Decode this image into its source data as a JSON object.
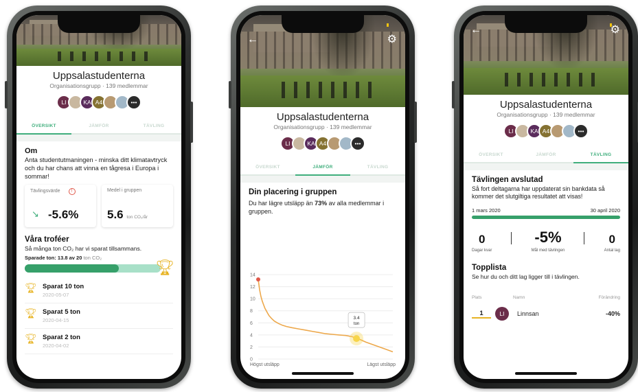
{
  "group": {
    "name": "Uppsalastudenterna",
    "type": "Organisationsgrupp",
    "separator": "·",
    "members": "139 medlemmar"
  },
  "avatars": [
    {
      "initials": "LI",
      "color": "#6b2d4a"
    },
    {
      "initials": "",
      "color": "#c9b8a0"
    },
    {
      "initials": "KA",
      "color": "#5a2c5c"
    },
    {
      "initials": "A4",
      "color": "#857232"
    },
    {
      "initials": "",
      "color": "#b89a72"
    },
    {
      "initials": "",
      "color": "#a2b8c8"
    },
    {
      "initials": "•••",
      "color": "#2b2b2b"
    }
  ],
  "tabs": {
    "overview": "ÖVERSIKT",
    "compare": "JÄMFÖR",
    "competition": "TÄVLING"
  },
  "overview": {
    "about_title": "Om",
    "about_text": "Anta studentutmaningen - minska ditt klimatavtryck och du har chans att vinna en tågresa i Europa i sommar!",
    "comp_label": "Tävlingsvärde",
    "comp_value": "-5.6%",
    "avg_label": "Medel i gruppen",
    "avg_value": "5.6",
    "avg_unit": "ton CO₂/år",
    "trophies_title": "Våra troféer",
    "trophies_text": "Så många ton CO₂ har vi sparat tillsammans.",
    "saved_label": "Sparade ton: 13.8 av 20",
    "saved_unit": "ton CO₂",
    "saved_value": 13.8,
    "saved_total": 20,
    "trophies": [
      {
        "name": "Sparat 10 ton",
        "date": "2020-05-07"
      },
      {
        "name": "Sparat 5 ton",
        "date": "2020-04-15"
      },
      {
        "name": "Sparat 2 ton",
        "date": "2020-04-02"
      }
    ]
  },
  "compare": {
    "title": "Din placering i gruppen",
    "text_pre": "Du har lägre utsläpp än ",
    "text_pct": "73%",
    "text_post": " av alla medlemmar i gruppen.",
    "x_left": "Högst utsläpp",
    "x_right": "Lägst utsläpp",
    "marker_value": "3.4",
    "marker_unit": "ton"
  },
  "chart_data": {
    "type": "line",
    "title": "",
    "xlabel": "",
    "ylabel": "",
    "ylim": [
      0,
      14
    ],
    "yticks": [
      0,
      2,
      4,
      6,
      8,
      10,
      12,
      14
    ],
    "grid": true,
    "x_labels": [
      "Högst utsläpp",
      "Lägst utsläpp"
    ],
    "series": [
      {
        "x": [
          0,
          1,
          2,
          3,
          4,
          5,
          6,
          7,
          8,
          10,
          12,
          15,
          18,
          21,
          25,
          30,
          35,
          40,
          45,
          50,
          55,
          60,
          65,
          70,
          73,
          76,
          80,
          85,
          90,
          95,
          100
        ],
        "values": [
          13.2,
          11.5,
          10.4,
          9.6,
          9.0,
          8.4,
          8.0,
          7.6,
          7.2,
          6.7,
          6.3,
          5.9,
          5.6,
          5.4,
          5.2,
          5.0,
          4.8,
          4.6,
          4.4,
          4.2,
          4.1,
          4.0,
          3.9,
          3.7,
          3.4,
          3.2,
          2.8,
          2.4,
          2.0,
          1.6,
          1.2
        ]
      }
    ],
    "highlight": {
      "x": 73,
      "y": 3.4,
      "label": "3.4 ton"
    },
    "start_point": {
      "x": 0,
      "y": 13.2
    },
    "colors": {
      "line": "#eda84b",
      "start": "#e0584a",
      "highlight": "#f7d54a"
    }
  },
  "competition": {
    "title": "Tävlingen avslutad",
    "text": "Så fort deltagarna har uppdaterat sin bankdata så kommer det slutgiltiga resultatet att visas!",
    "start": "1 mars 2020",
    "end": "30 april 2020",
    "stats": [
      {
        "value": "0",
        "label": "Dagar kvar"
      },
      {
        "value": "-5%",
        "label": "Mål med tävlingen"
      },
      {
        "value": "0",
        "label": "Antal lag"
      }
    ],
    "toplist_title": "Topplista",
    "toplist_text": "Se hur du och ditt lag ligger till i tävlingen.",
    "col_place": "Plats",
    "col_name": "Namn",
    "col_change": "Förändring",
    "rows": [
      {
        "place": "1",
        "initials": "LI",
        "name": "Linnsan",
        "change": "-40%"
      }
    ]
  },
  "colors": {
    "accent": "#3fae7c",
    "progress_fill": "#36a06a",
    "progress_bg": "#a8e0c8",
    "trophy": "#e7b323",
    "trend": "#3fae7c"
  }
}
